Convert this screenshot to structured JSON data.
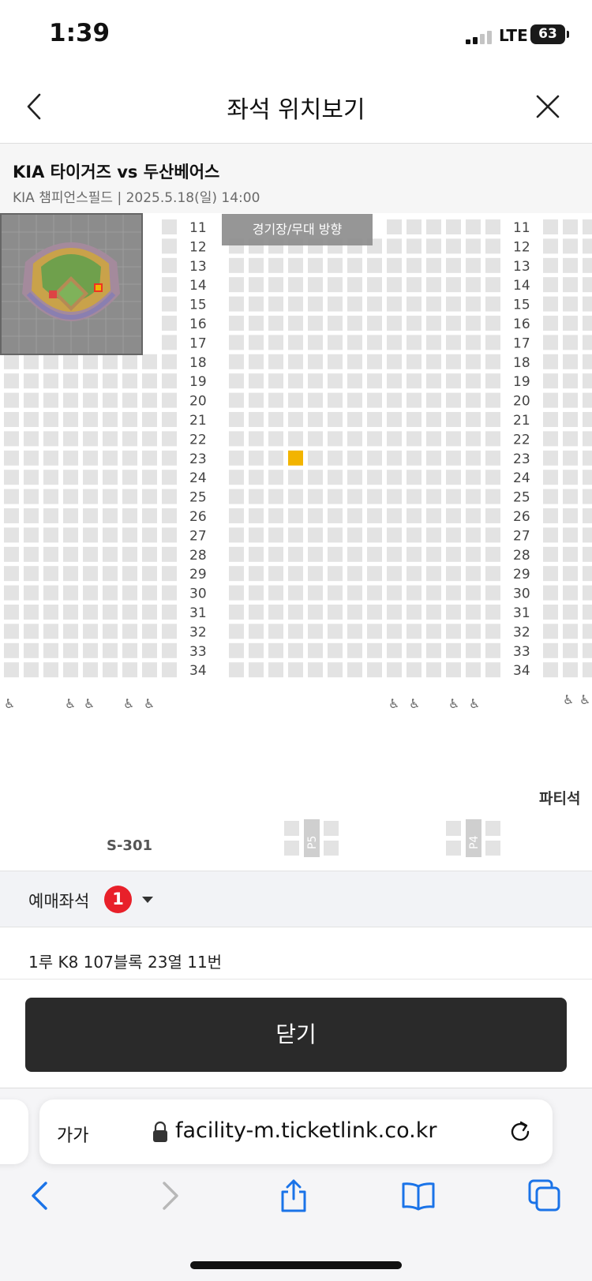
{
  "status_bar": {
    "time": "1:39",
    "network": "LTE",
    "battery": "63"
  },
  "nav": {
    "title": "좌석 위치보기",
    "back_icon": "chevron-left-icon",
    "close_icon": "close-icon"
  },
  "event": {
    "title": "KIA 타이거즈 vs 두산베어스",
    "subtitle": "KIA 챔피언스필드 | 2025.5.18(일) 14:00"
  },
  "seat_map": {
    "stage_label": "경기장/무대 방향",
    "rows_left": [
      "11",
      "12",
      "13",
      "14",
      "15",
      "16",
      "17",
      "18",
      "19",
      "20",
      "21",
      "22",
      "23",
      "24",
      "25",
      "26",
      "27",
      "28",
      "29",
      "30",
      "31",
      "32",
      "33",
      "34"
    ],
    "rows_right": [
      "11",
      "12",
      "13",
      "14",
      "15",
      "16",
      "17",
      "18",
      "19",
      "20",
      "21",
      "22",
      "23",
      "24",
      "25",
      "26",
      "27",
      "28",
      "29",
      "30",
      "31",
      "32",
      "33",
      "34"
    ],
    "selected_seat": {
      "row": "23",
      "seat": "11"
    },
    "party_label": "파티석",
    "section_label": "S-301",
    "pillar_labels": [
      "P5",
      "P4"
    ],
    "wheelchair_icon": "wheelchair-icon",
    "colors": {
      "seat": "#e3e3e3",
      "selected": "#f2b400",
      "row_number": "#444444"
    }
  },
  "seat_select": {
    "label": "예매좌석",
    "count": "1",
    "caret_icon": "caret-down-icon"
  },
  "seat_detail": "1루 K8 107블록 23열 11번",
  "close_button": "닫기",
  "safari": {
    "aa_label": "가가",
    "url": "facility-m.ticketlink.co.kr",
    "icons": [
      "lock-icon",
      "reload-icon",
      "back-icon",
      "forward-icon",
      "share-icon",
      "bookmarks-icon",
      "tabs-icon"
    ]
  }
}
